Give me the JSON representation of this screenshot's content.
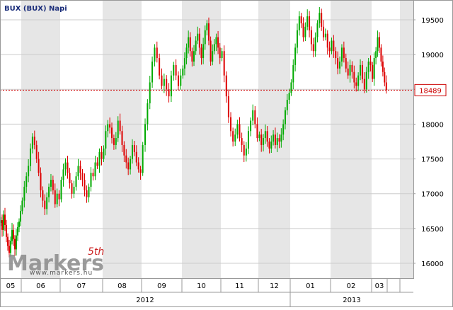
{
  "chart_data": {
    "type": "candlestick",
    "title": "BUX (BUX)  Napi",
    "current_value": "18489",
    "ylim": [
      15800,
      19800
    ],
    "yticks": [
      "16000",
      "16500",
      "17000",
      "17500",
      "18000",
      "18500",
      "19000",
      "19500"
    ],
    "months": [
      "05",
      "06",
      "07",
      "08",
      "09",
      "10",
      "11",
      "12",
      "01",
      "02",
      "03"
    ],
    "years": [
      "2012",
      "2013"
    ],
    "series": [
      {
        "month": "05",
        "closes": [
          16620,
          16480,
          16700,
          16550,
          16380,
          16250,
          16150,
          16320,
          16480,
          16350,
          16200,
          16400,
          16520,
          16600,
          16750
        ]
      },
      {
        "month": "06",
        "closes": [
          16900,
          17100,
          17250,
          17400,
          17650,
          17820,
          17700,
          17500,
          17300,
          17050,
          16900,
          16780,
          16950,
          17100,
          17200,
          17050,
          16850,
          17000,
          16920
        ]
      },
      {
        "month": "07",
        "closes": [
          17200,
          17350,
          17450,
          17300,
          17150,
          17000,
          17100,
          17250,
          17400,
          17300,
          17200,
          17050,
          16950,
          17100,
          17300,
          17250,
          17450,
          17400,
          17600,
          17500
        ]
      },
      {
        "month": "08",
        "closes": [
          17650,
          17900,
          18000,
          17950,
          17800,
          17700,
          17800,
          18050,
          17900,
          17700,
          17550,
          17450,
          17350,
          17500,
          17700,
          17600,
          17450,
          17350,
          17300
        ]
      },
      {
        "month": "09",
        "closes": [
          17700,
          18000,
          18300,
          18600,
          18900,
          19100,
          18950,
          18700,
          18550,
          18650,
          18500,
          18400,
          18700,
          18850,
          18700,
          18550,
          18700
        ]
      },
      {
        "month": "10",
        "closes": [
          18800,
          18950,
          19100,
          19250,
          19050,
          18900,
          19050,
          19200,
          19300,
          19100,
          18950,
          19150,
          19350,
          19450,
          19200,
          18900,
          19050,
          19150,
          19250,
          19100,
          18950
        ]
      },
      {
        "month": "11",
        "closes": [
          19050,
          18700,
          18400,
          18100,
          17900,
          17750,
          17850,
          18000,
          17800,
          17700,
          17550,
          17650,
          17900,
          18050,
          18200,
          18000,
          17800
        ]
      },
      {
        "month": "12",
        "closes": [
          17850,
          17700,
          17800,
          17900,
          17750,
          17650,
          17750,
          17850,
          17700,
          17800,
          17750,
          17850,
          18000,
          18200,
          18350,
          18450
        ]
      },
      {
        "month": "01",
        "closes": [
          18600,
          18850,
          19100,
          19350,
          19550,
          19450,
          19250,
          19400,
          19550,
          19350,
          19150,
          19050,
          19250,
          19450,
          19600,
          19400,
          19250,
          19300,
          19100,
          19050
        ]
      },
      {
        "month": "02",
        "closes": [
          19200,
          19050,
          18950,
          18800,
          18900,
          19100,
          18950,
          18800,
          18700,
          18850,
          18750,
          18600,
          18550,
          18700,
          18850,
          18650,
          18500,
          18750,
          18900,
          18850
        ]
      },
      {
        "month": "03",
        "closes": [
          18650,
          18950,
          19050,
          19250,
          19100,
          18900,
          18750,
          18600,
          18489
        ]
      }
    ]
  },
  "watermark": {
    "brand": "Markers",
    "edition": "5th",
    "url": "www.markers.hu"
  },
  "colors": {
    "up": "#00aa00",
    "down": "#dd0000",
    "band": "#e6e6e6",
    "grid": "#cccccc",
    "current": "#cc0000",
    "title": "#1a2d7a"
  }
}
